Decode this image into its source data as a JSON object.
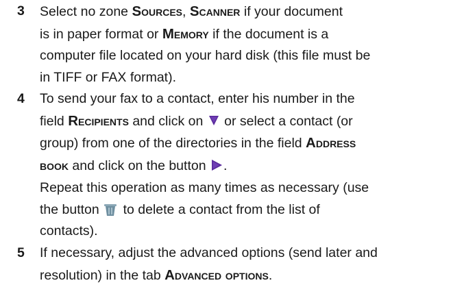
{
  "steps": [
    {
      "number": "3",
      "lines": [
        {
          "t1": "Select no zone ",
          "b1": "Sources",
          "t2": ", ",
          "b2": "Scanner",
          "t3": " if your document"
        },
        {
          "t1": "is in paper format or ",
          "b1": "Memory",
          "t2": " if the document is a"
        },
        {
          "t1": "computer file located on your hard disk (this file must be"
        },
        {
          "t1": "in TIFF or FAX format)."
        }
      ]
    },
    {
      "number": "4",
      "lines": [
        {
          "t1": "To send your fax to a contact, enter his number in the"
        },
        {
          "t1": "field ",
          "b1": "Recipients",
          "t2": " and click on ",
          "t3": " or select a contact (or"
        },
        {
          "t1": "group) from one of the directories in the field ",
          "b1": "Address"
        },
        {
          "b1": "book",
          "t1": " and click on the button ",
          "t2": "."
        },
        {
          "t1": "Repeat this operation as many times as necessary (use"
        },
        {
          "t1": "the button ",
          "t2": " to delete a contact from the list of"
        },
        {
          "t1": "contacts)."
        }
      ]
    },
    {
      "number": "5",
      "lines": [
        {
          "t1": "If necessary, adjust the advanced options (send later and"
        },
        {
          "t1": "resolution) in the tab ",
          "b1": "Advanced options",
          "t2": "."
        }
      ]
    }
  ],
  "icons": {
    "dropdown_arrow": {
      "name": "down-triangle-icon",
      "color": "#5a2a9c"
    },
    "add_button": {
      "name": "right-triangle-icon",
      "color": "#5a2a9c"
    },
    "delete_button": {
      "name": "trash-bin-icon",
      "color": "#6f8fa0"
    }
  }
}
